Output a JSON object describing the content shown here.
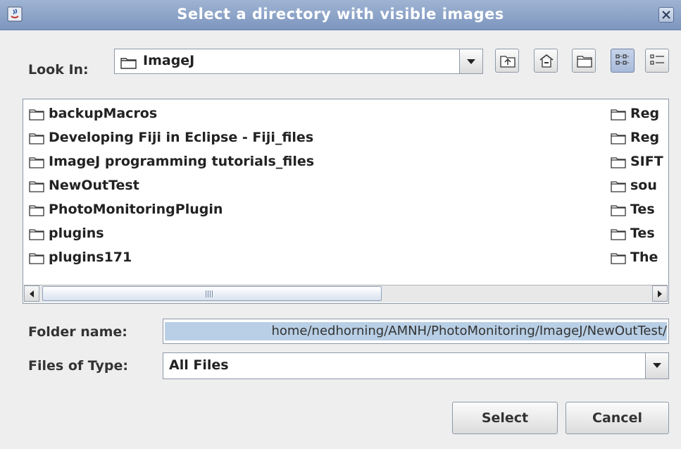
{
  "window": {
    "title": "Select a directory with visible images"
  },
  "look_in": {
    "label": "Look In:",
    "value": "ImageJ"
  },
  "toolbar": {
    "icons": [
      "up-one-level-icon",
      "home-icon",
      "new-folder-icon",
      "list-view-icon",
      "details-view-icon"
    ]
  },
  "files": {
    "left": [
      "backupMacros",
      "Developing Fiji in Eclipse - Fiji_files",
      "ImageJ programming tutorials_files",
      "NewOutTest",
      "PhotoMonitoringPlugin",
      "plugins",
      "plugins171"
    ],
    "right": [
      "Reg",
      "Reg",
      "SIFT",
      "sou",
      "Tes",
      "Tes",
      "The"
    ]
  },
  "folder_name": {
    "label": "Folder name:",
    "value": "/home/nedhorning/AMNH/PhotoMonitoring/ImageJ/NewOutTest"
  },
  "files_of_type": {
    "label": "Files of Type:",
    "value": "All Files"
  },
  "buttons": {
    "select": "Select",
    "cancel": "Cancel"
  }
}
